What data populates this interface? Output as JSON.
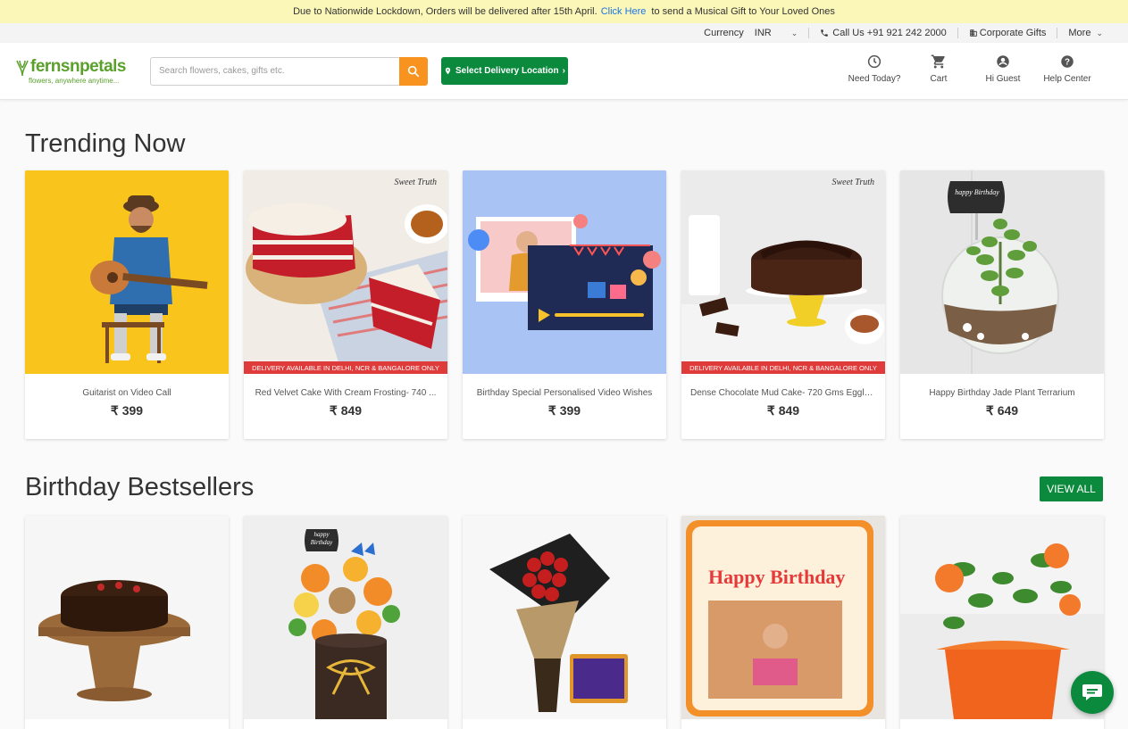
{
  "banner": {
    "text_before": "Due to Nationwide Lockdown, Orders will be delivered after 15th April.",
    "link": "Click Here",
    "text_after": "to send a Musical Gift to Your Loved Ones"
  },
  "topbar": {
    "currency_label": "Currency",
    "currency_value": "INR",
    "call": "Call Us +91 921 242 2000",
    "corporate": "Corporate Gifts",
    "more": "More"
  },
  "header": {
    "logo_name": "fernsnpetals",
    "logo_tagline": "flowers, anywhere anytime...",
    "search_placeholder": "Search flowers, cakes, gifts etc.",
    "location_button": "Select Delivery Location",
    "icons": [
      {
        "label": "Need Today?",
        "icon": "clock-icon"
      },
      {
        "label": "Cart",
        "icon": "cart-icon"
      },
      {
        "label": "Hi Guest",
        "icon": "user-icon"
      },
      {
        "label": "Help Center",
        "icon": "help-icon"
      }
    ]
  },
  "trending": {
    "title": "Trending Now",
    "products": [
      {
        "title": "Guitarist on Video Call",
        "price": "₹ 399",
        "strip": ""
      },
      {
        "title": "Red Velvet Cake With Cream Frosting- 740 ...",
        "price": "₹ 849",
        "strip": "DELIVERY AVAILABLE IN DELHI, NCR & BANGALORE ONLY"
      },
      {
        "title": "Birthday Special Personalised Video Wishes",
        "price": "₹ 399",
        "strip": ""
      },
      {
        "title": "Dense Chocolate Mud Cake- 720 Gms Eggle...",
        "price": "₹ 849",
        "strip": "DELIVERY AVAILABLE IN DELHI, NCR & BANGALORE ONLY"
      },
      {
        "title": "Happy Birthday Jade Plant Terrarium",
        "price": "₹ 649",
        "strip": ""
      }
    ]
  },
  "bestsellers": {
    "title": "Birthday Bestsellers",
    "view_all": "VIEW ALL"
  },
  "image_text": {
    "sweet_truth": "Sweet Truth",
    "happy_birthday_tag": "happy Birthday",
    "cushion_text": "Happy Birthday"
  },
  "colors": {
    "brand_green": "#0b8a3e",
    "search_orange": "#f7931e",
    "banner_bg": "#fbf7b8",
    "delivery_strip": "#e03b3b"
  }
}
